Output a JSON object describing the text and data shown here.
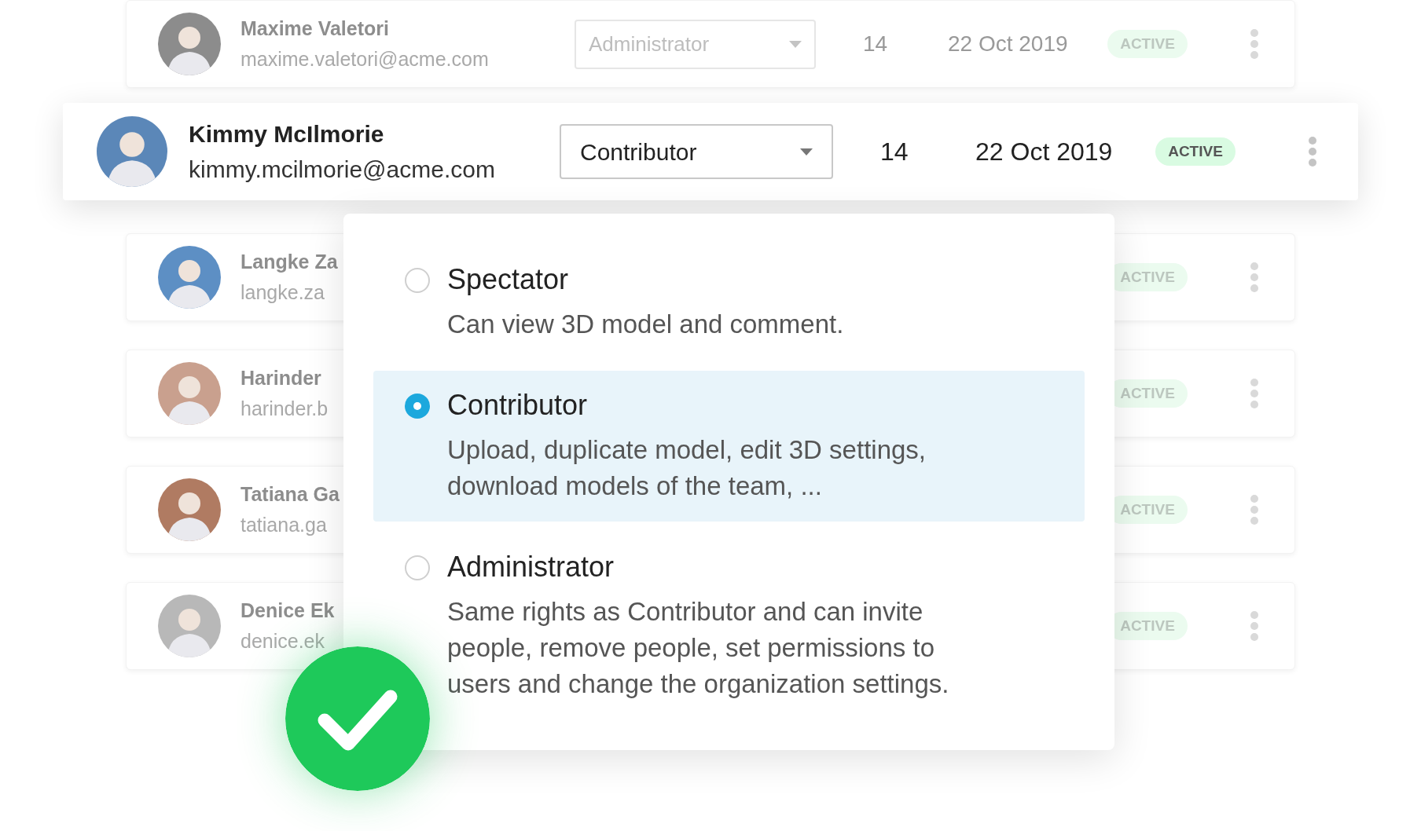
{
  "users": [
    {
      "name": "Maxime Valetori",
      "email": "maxime.valetori@acme.com",
      "role": "Administrator",
      "count": "14",
      "date": "22 Oct 2019",
      "status": "ACTIVE",
      "focused": false
    },
    {
      "name": "Kimmy McIlmorie",
      "email": "kimmy.mcilmorie@acme.com",
      "role": "Contributor",
      "count": "14",
      "date": "22 Oct 2019",
      "status": "ACTIVE",
      "focused": true
    },
    {
      "name": "Langke Za",
      "email": "langke.za",
      "status": "ACTIVE",
      "focused": false
    },
    {
      "name": "Harinder",
      "email": "harinder.b",
      "status": "ACTIVE",
      "focused": false
    },
    {
      "name": "Tatiana Ga",
      "email": "tatiana.ga",
      "status": "ACTIVE",
      "focused": false
    },
    {
      "name": "Denice Ek",
      "email": "denice.ek",
      "status": "ACTIVE",
      "focused": false
    }
  ],
  "role_menu": {
    "options": [
      {
        "label": "Spectator",
        "description": "Can view 3D model and comment.",
        "selected": false
      },
      {
        "label": "Contributor",
        "description": "Upload, duplicate model, edit 3D settings, download models of the team, ...",
        "selected": true
      },
      {
        "label": "Administrator",
        "description": "Same rights as Contributor and can invite people, remove people, set permissions to users and change the organization settings.",
        "selected": false
      }
    ]
  }
}
